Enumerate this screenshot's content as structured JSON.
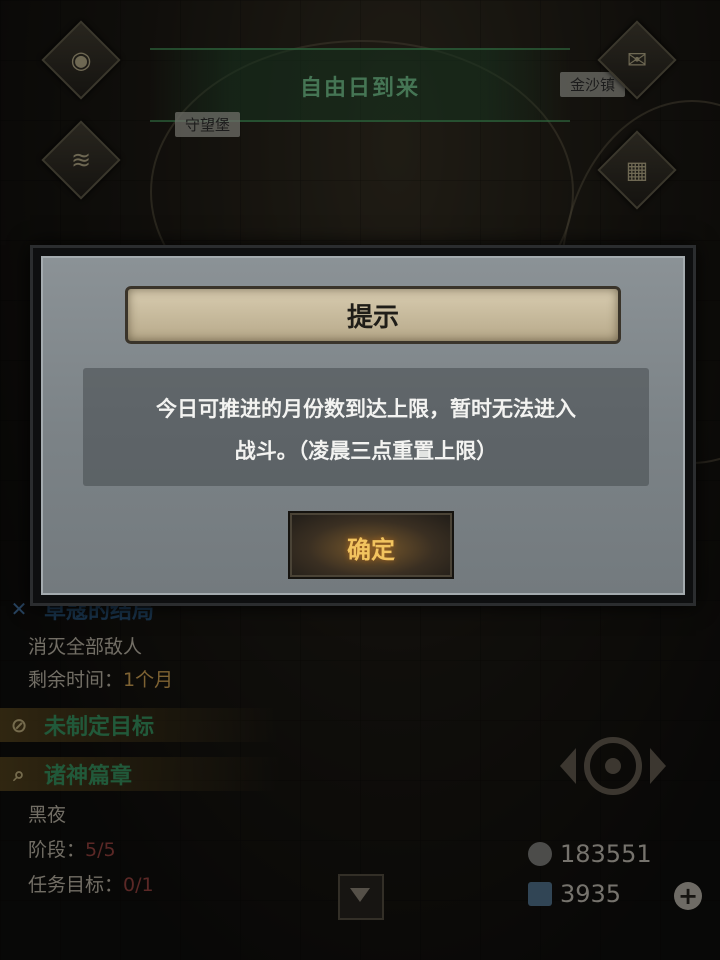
{
  "map": {
    "banner_text": "自由日到来",
    "place_left": "守望堡",
    "place_right": "金沙镇"
  },
  "dialog": {
    "title": "提示",
    "message_line1": "今日可推进的月份数到达上限，暂时无法进入",
    "message_line2": "战斗。（凌晨三点重置上限）",
    "ok_label": "确定"
  },
  "quest": {
    "title": "草寇的结局",
    "objective": "消灭全部敌人",
    "remaining_label": "剩余时间：",
    "remaining_value": "1个月"
  },
  "goal": {
    "title": "未制定目标"
  },
  "chapter": {
    "title": "诸神篇章",
    "subtitle": "黑夜",
    "stage_label": "阶段：",
    "stage_value": "5/5",
    "task_label": "任务目标：",
    "task_value": "0/1"
  },
  "resources": {
    "silver": "183551",
    "crystal": "3935"
  },
  "colors": {
    "quest_title": "#2e5f8a",
    "goal_title": "#3da36a",
    "chapter_title": "#3da36a",
    "gold_value": "#e5b35c",
    "red_value": "#a64a46",
    "ok_text": "#f2c45f"
  }
}
